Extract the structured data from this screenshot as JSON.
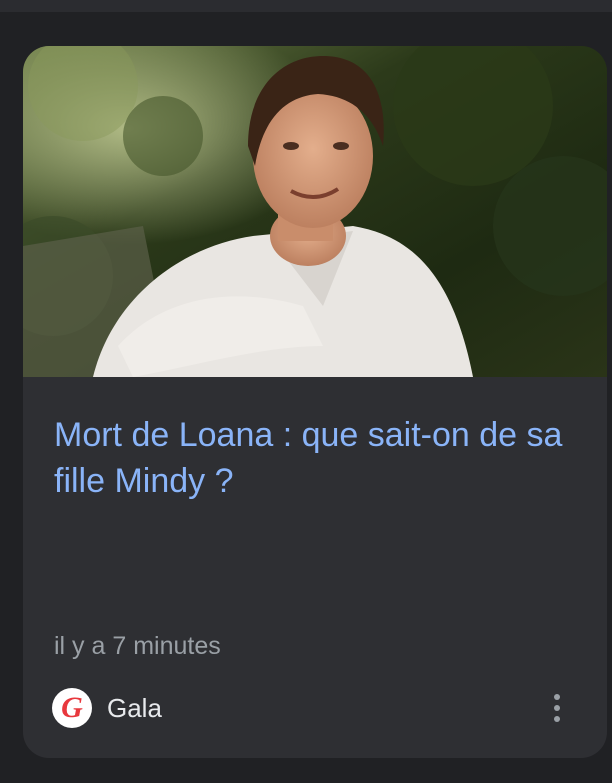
{
  "article": {
    "headline": "Mort de Loana : que sait-on de sa fille Mindy ?",
    "timestamp": "il y a 7 minutes",
    "source": {
      "name": "Gala",
      "logo_letter": "G",
      "logo_color": "#e8383d"
    },
    "menu_icon": "more-vert-icon"
  },
  "colors": {
    "headline": "#8ab4f8",
    "card_background": "#2e2f33",
    "page_background": "#202124",
    "secondary_text": "#9aa0a6"
  }
}
